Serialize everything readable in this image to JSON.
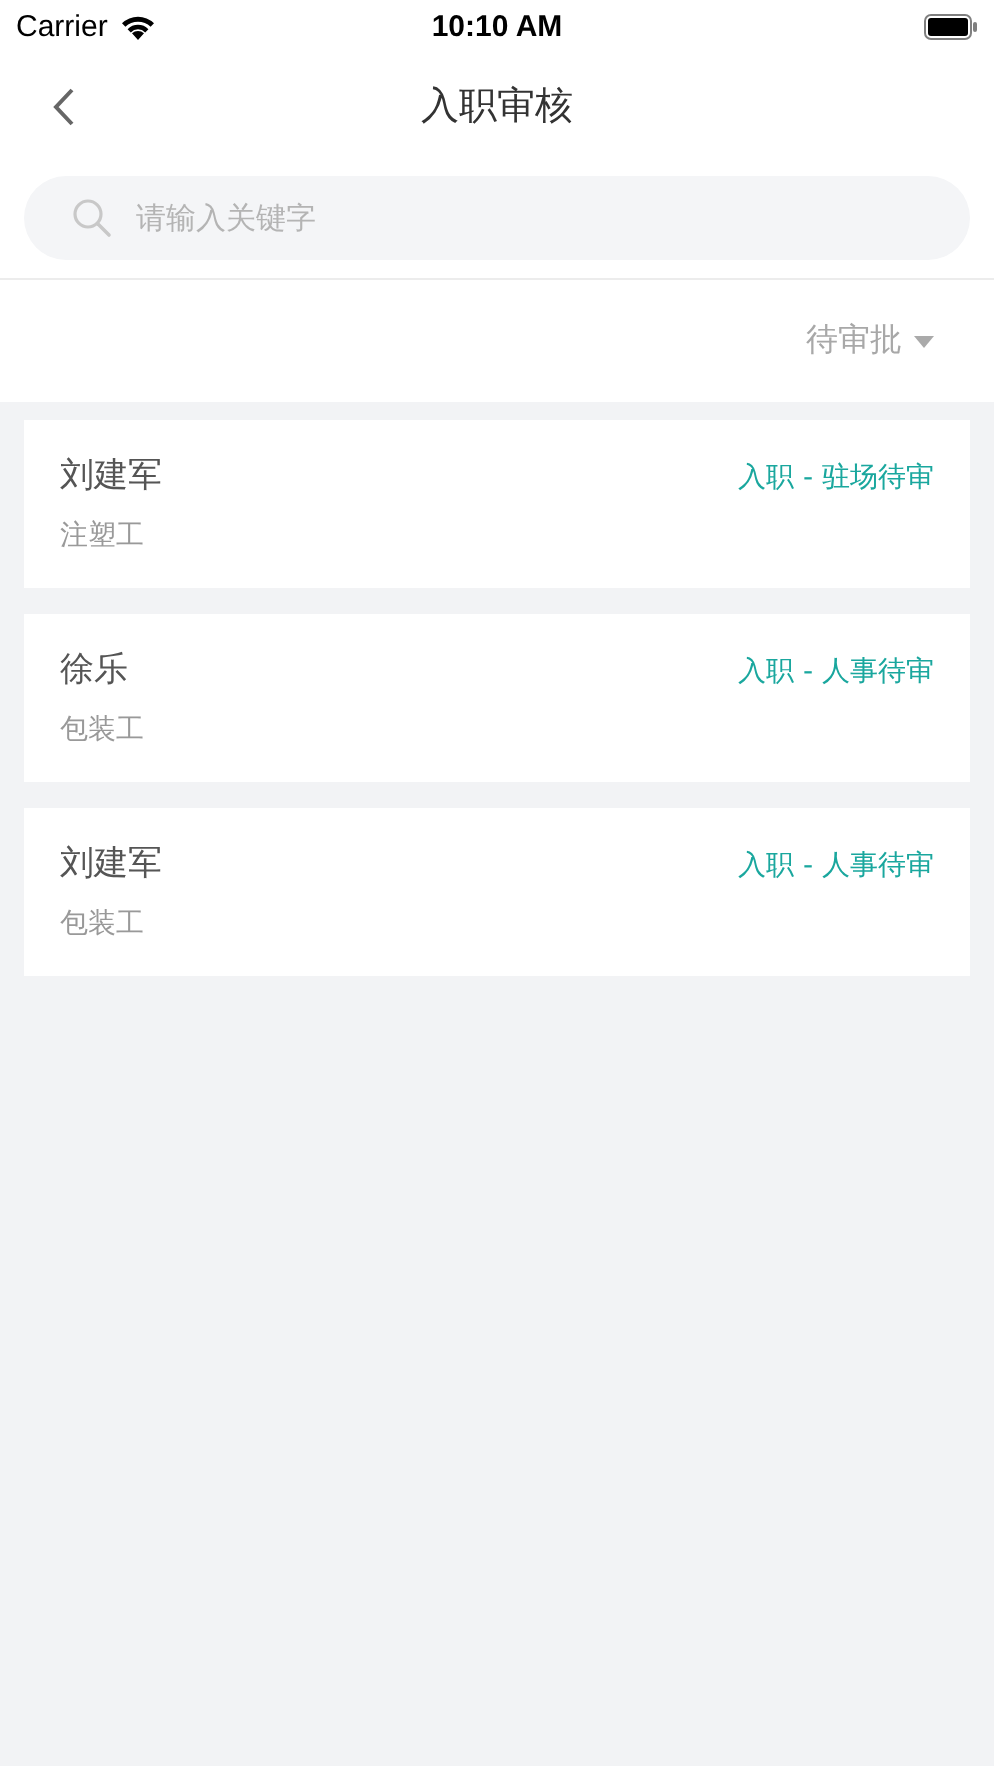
{
  "status_bar": {
    "carrier": "Carrier",
    "time": "10:10 AM"
  },
  "nav": {
    "title": "入职审核"
  },
  "search": {
    "placeholder": "请输入关键字"
  },
  "filter": {
    "label": "待审批"
  },
  "items": [
    {
      "name": "刘建军",
      "job": "注塑工",
      "status": "入职 - 驻场待审"
    },
    {
      "name": "徐乐",
      "job": "包装工",
      "status": "入职 - 人事待审"
    },
    {
      "name": "刘建军",
      "job": "包装工",
      "status": "入职 - 人事待审"
    }
  ]
}
